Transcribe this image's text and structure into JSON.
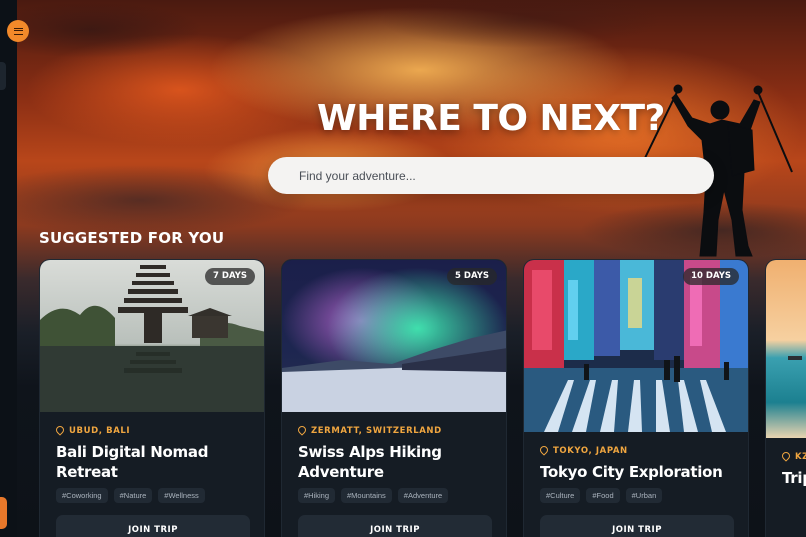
{
  "hero": {
    "title": "WHERE TO NEXT?",
    "search_placeholder": "Find your adventure..."
  },
  "section": {
    "title": "SUGGESTED FOR YOU"
  },
  "cards": [
    {
      "days": "7 DAYS",
      "location": "UBUD, BALI",
      "title": "Bali Digital Nomad Retreat",
      "tags": [
        "#Coworking",
        "#Nature",
        "#Wellness"
      ],
      "cta": "JOIN TRIP"
    },
    {
      "days": "5 DAYS",
      "location": "ZERMATT, SWITZERLAND",
      "title": "Swiss Alps Hiking Adventure",
      "tags": [
        "#Hiking",
        "#Mountains",
        "#Adventure"
      ],
      "cta": "JOIN TRIP"
    },
    {
      "days": "10 DAYS",
      "location": "TOKYO, JAPAN",
      "title": "Tokyo City Exploration",
      "tags": [
        "#Culture",
        "#Food",
        "#Urban"
      ],
      "cta": "JOIN TRIP"
    },
    {
      "location": "KZ",
      "title": "Trip"
    }
  ],
  "icons": {
    "menu": "menu-icon",
    "pin": "location-pin-icon"
  },
  "colors": {
    "accent": "#f2892a",
    "location_text": "#f0a640",
    "card_bg": "#151c24",
    "page_bg": "#0d1218"
  }
}
